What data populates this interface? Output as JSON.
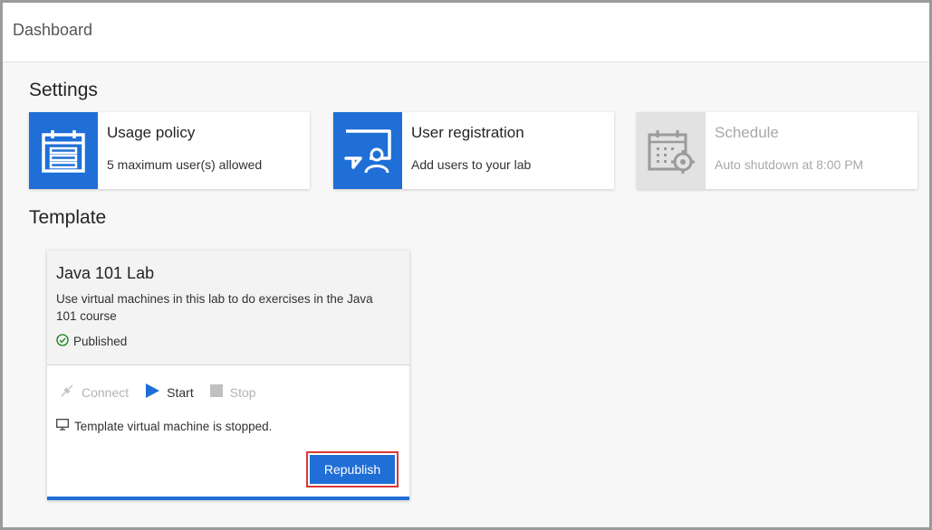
{
  "header": {
    "title": "Dashboard"
  },
  "settings": {
    "title": "Settings",
    "cards": [
      {
        "title": "Usage policy",
        "subtitle": "5 maximum user(s) allowed",
        "icon": "calendar-list-icon",
        "enabled": true
      },
      {
        "title": "User registration",
        "subtitle": "Add users to your lab",
        "icon": "user-chat-icon",
        "enabled": true
      },
      {
        "title": "Schedule",
        "subtitle": "Auto shutdown at 8:00 PM",
        "icon": "calendar-gear-icon",
        "enabled": false
      }
    ]
  },
  "template": {
    "title": "Template",
    "card": {
      "name": "Java 101 Lab",
      "description": "Use virtual machines in this lab to do exercises in the Java 101 course",
      "status": "Published",
      "actions": [
        {
          "label": "Connect",
          "icon": "plug-icon",
          "enabled": false
        },
        {
          "label": "Start",
          "icon": "play-icon",
          "enabled": true
        },
        {
          "label": "Stop",
          "icon": "stop-icon",
          "enabled": false
        }
      ],
      "vm_state": "Template virtual machine is stopped.",
      "republish_label": "Republish"
    }
  },
  "colors": {
    "accent": "#1f6fd6",
    "highlight": "#d9383a",
    "success": "#107c10"
  }
}
